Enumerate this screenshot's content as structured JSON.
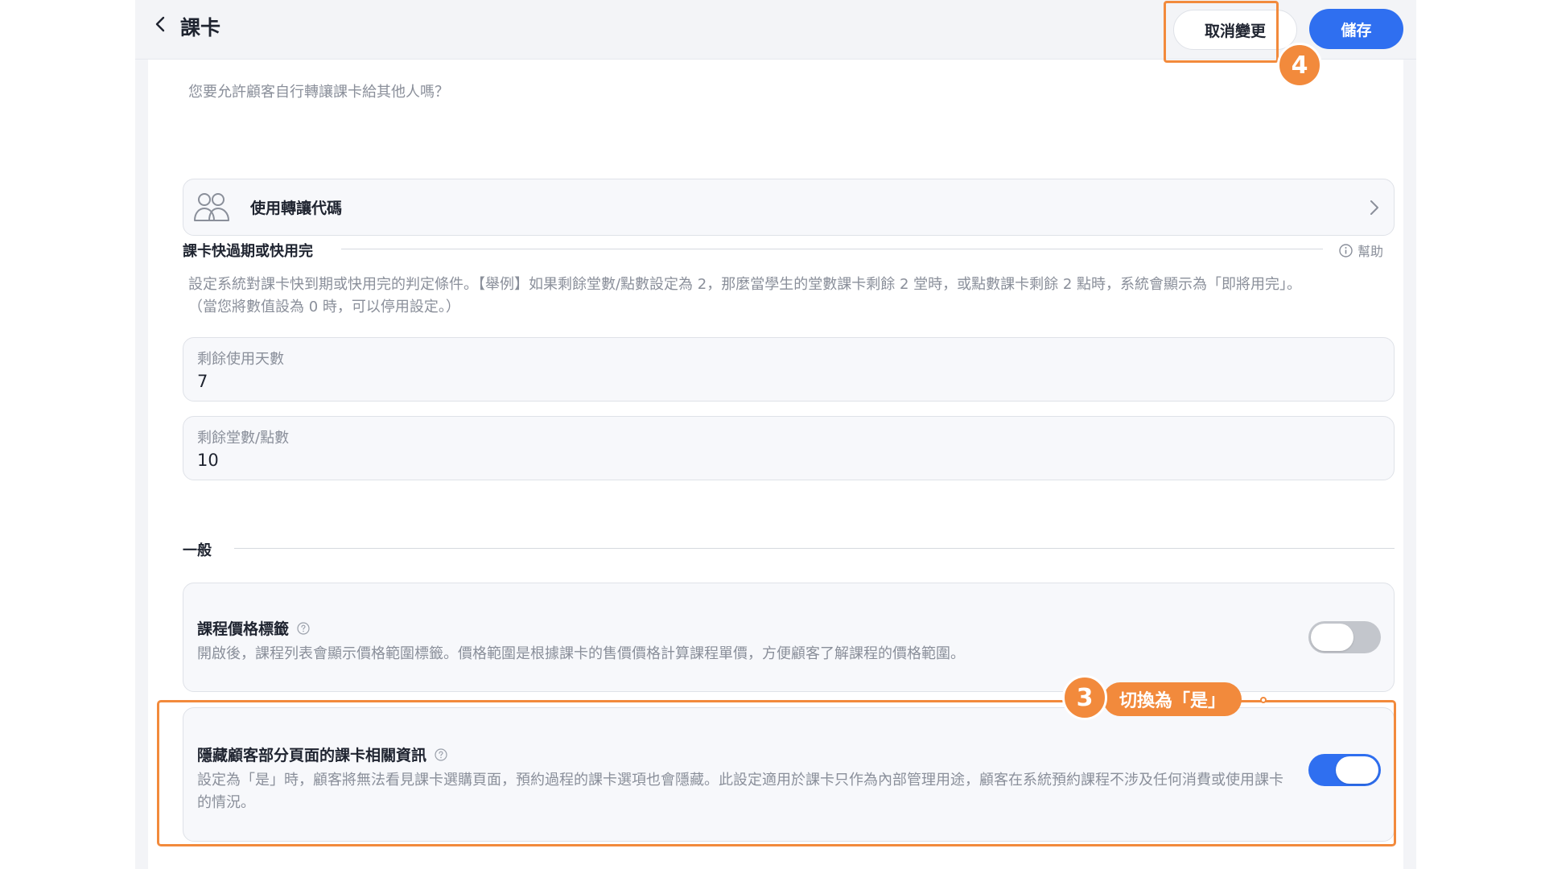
{
  "header": {
    "title": "課卡",
    "cancel_label": "取消變更",
    "save_label": "儲存"
  },
  "transfer": {
    "question": "您要允許顧客自行轉讓課卡給其他人嗎？",
    "option_label": "使用轉讓代碼"
  },
  "expiry": {
    "section_title": "課卡快過期或快用完",
    "help_label": "幫助",
    "description_line1": "設定系統對課卡快到期或快用完的判定條件。【舉例】如果剩餘堂數/點數設定為 2，那麼當學生的堂數課卡剩餘 2 堂時，或點數課卡剩餘 2 點時，系統會顯示為「即將用完」。",
    "description_line2": "（當您將數值設為 0 時，可以停用設定。）",
    "fields": [
      {
        "label": "剩餘使用天數",
        "value": "7"
      },
      {
        "label": "剩餘堂數/點數",
        "value": "10"
      }
    ]
  },
  "general": {
    "section_title": "一般",
    "settings": [
      {
        "title": "課程價格標籤",
        "description": "開啟後，課程列表會顯示價格範圍標籤。價格範圍是根據課卡的售價價格計算課程單價，方便顧客了解課程的價格範圍。",
        "enabled": false
      },
      {
        "title": "隱藏顧客部分頁面的課卡相關資訊",
        "description": "設定為「是」時，顧客將無法看見課卡選購頁面，預約過程的課卡選項也會隱藏。此設定適用於課卡只作為內部管理用途，顧客在系統預約課程不涉及任何消費或使用課卡的情況。",
        "enabled": true
      }
    ]
  },
  "annotations": {
    "step3_number": "3",
    "step3_text": "切換為「是」",
    "step4_number": "4",
    "color": "#f28a3c"
  },
  "colors": {
    "accent": "#2f6ff0",
    "annotation": "#f28a3c"
  }
}
